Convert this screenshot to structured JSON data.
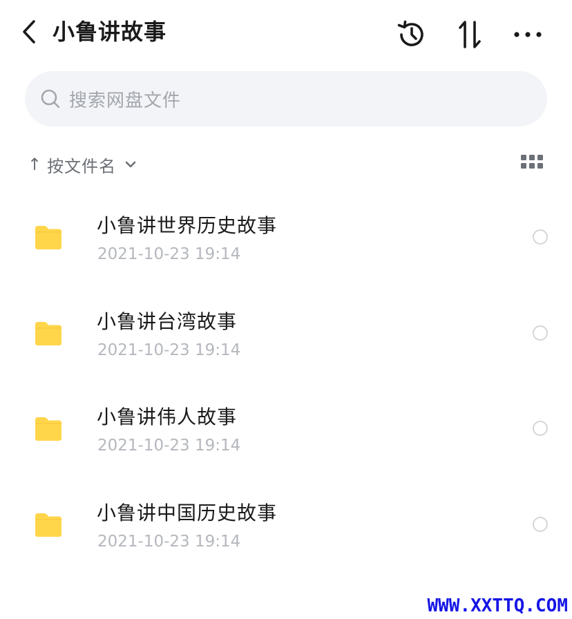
{
  "header": {
    "title": "小鲁讲故事",
    "back_icon": "chevron-left-icon",
    "history_icon": "history-clock-icon",
    "sort_icon": "sort-arrows-icon",
    "more_icon": "more-dots-icon"
  },
  "search": {
    "placeholder": "搜索网盘文件",
    "icon": "search-icon"
  },
  "sort": {
    "arrow": "↑",
    "label": "按文件名",
    "chevron_icon": "chevron-down-icon",
    "view_toggle_icon": "grid-view-icon"
  },
  "files": [
    {
      "name": "小鲁讲世界历史故事",
      "date": "2021-10-23 19:14",
      "icon": "folder-icon"
    },
    {
      "name": "小鲁讲台湾故事",
      "date": "2021-10-23 19:14",
      "icon": "folder-icon"
    },
    {
      "name": "小鲁讲伟人故事",
      "date": "2021-10-23 19:14",
      "icon": "folder-icon"
    },
    {
      "name": "小鲁讲中国历史故事",
      "date": "2021-10-23 19:14",
      "icon": "folder-icon"
    }
  ],
  "watermark": "WWW.XXTTQ.COM",
  "colors": {
    "folder": "#FFD54A",
    "watermark": "#1515E6",
    "search_bg": "#F2F4F7"
  }
}
